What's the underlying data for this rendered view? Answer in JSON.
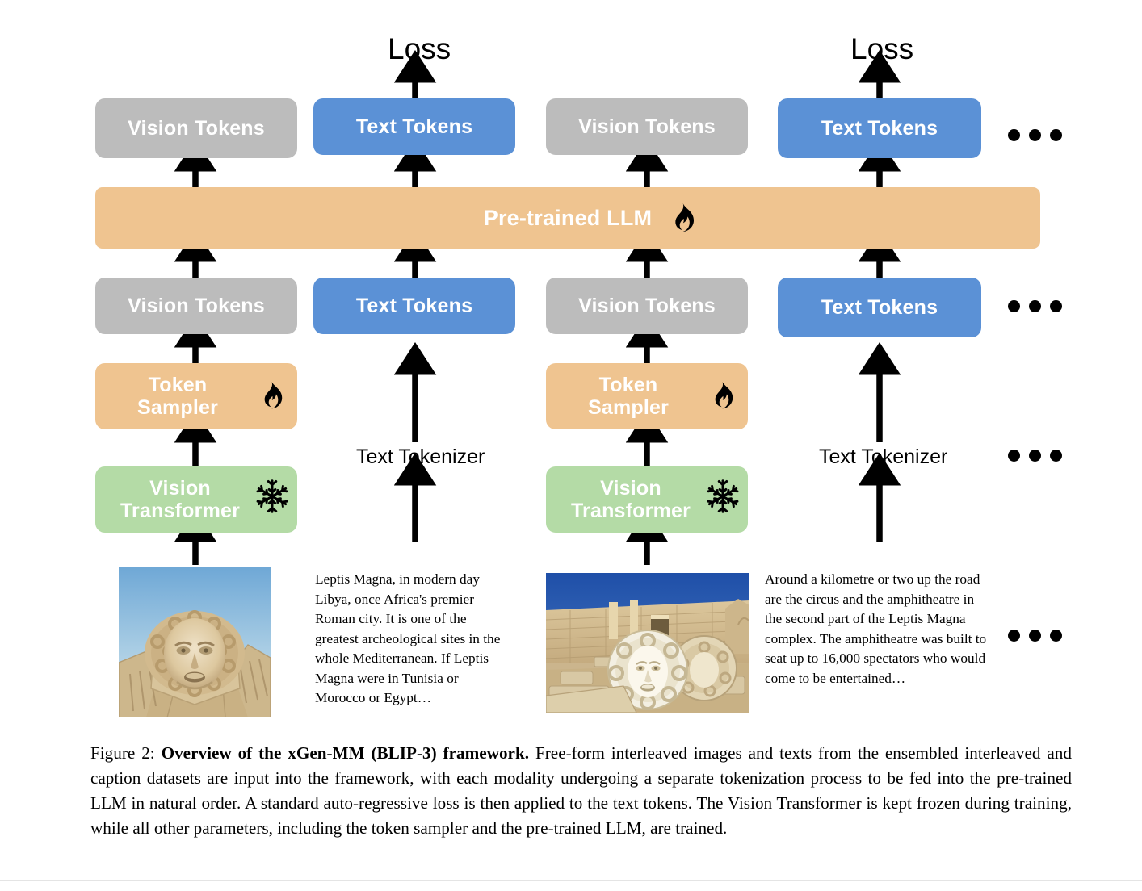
{
  "figure": {
    "loss_labels": [
      "Loss",
      "Loss"
    ],
    "ellipsis": "•••",
    "colors": {
      "vision_tokens": "#bcbcbc",
      "text_tokens": "#5b91d6",
      "llm": "#efc490",
      "token_sampler": "#efc490",
      "vision_transformer": "#b4dba6",
      "arrow": "#000000",
      "background": "#ffffff"
    },
    "blocks": {
      "vision_tokens": "Vision Tokens",
      "text_tokens": "Text Tokens",
      "llm": "Pre-trained LLM",
      "token_sampler": "Token\nSampler",
      "token_sampler_line1": "Token",
      "token_sampler_line2": "Sampler",
      "vision_transformer_line1": "Vision",
      "vision_transformer_line2": "Transformer",
      "text_tokenizer": "Text Tokenizer"
    },
    "icons": {
      "trainable": "flame-icon",
      "frozen": "snowflake-icon"
    },
    "columns": [
      {
        "index": 1,
        "modality": "vision",
        "top_token_label": "Vision Tokens",
        "bottom_token_label": "Vision Tokens",
        "encoder": "Vision Transformer",
        "sampler": "Token Sampler",
        "encoder_state": "frozen",
        "sampler_state": "trainable",
        "image_alt": "Medusa head carved relief at Leptis Magna"
      },
      {
        "index": 2,
        "modality": "text",
        "top_token_label": "Text Tokens",
        "bottom_token_label": "Text Tokens",
        "tokenizer": "Text Tokenizer",
        "has_loss": true,
        "text": "Leptis Magna, in modern day Libya, once Africa's premier Roman city. It is one of the greatest archeological sites in the whole Mediterranean. If Leptis Magna were in Tunisia or Morocco or Egypt…"
      },
      {
        "index": 3,
        "modality": "vision",
        "top_token_label": "Vision Tokens",
        "bottom_token_label": "Vision Tokens",
        "encoder": "Vision Transformer",
        "sampler": "Token Sampler",
        "encoder_state": "frozen",
        "sampler_state": "trainable",
        "image_alt": "Ruins of Leptis Magna with fallen Medusa medallions"
      },
      {
        "index": 4,
        "modality": "text",
        "top_token_label": "Text Tokens",
        "bottom_token_label": "Text Tokens",
        "tokenizer": "Text Tokenizer",
        "has_loss": true,
        "text": "Around a kilometre or two up the road are the circus and the amphitheatre in the second part of the Leptis Magna complex. The amphitheatre was built to seat up to 16,000 spectators who would come to be entertained…"
      }
    ],
    "paragraphs": {
      "left": "Leptis Magna, in modern day Libya, once Africa's premier Roman city. It is one of the greatest archeological sites in the whole Mediterranean. If Leptis Magna were in Tunisia or Morocco or Egypt…",
      "right": "Around a kilometre or two up the road are the circus and the amphitheatre in the second part of the Leptis Magna complex. The amphitheatre was built to seat up to 16,000 spectators who would come to be entertained…"
    }
  },
  "caption": {
    "figure_number": "Figure 2:",
    "title": "Overview of the xGen-MM (BLIP-3) framework.",
    "body": "Free-form interleaved images and texts from the ensembled interleaved and caption datasets are input into the framework, with each modality undergoing a separate tokenization process to be fed into the pre-trained LLM in natural order. A standard auto-regressive loss is then applied to the text tokens. The Vision Transformer is kept frozen during training, while all other parameters, including the token sampler and the pre-trained LLM, are trained."
  }
}
